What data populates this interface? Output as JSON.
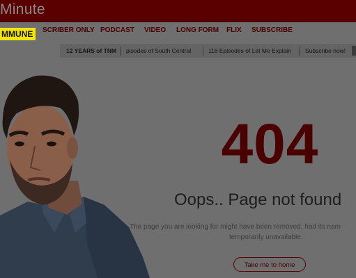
{
  "header": {
    "logo_text": "Minute",
    "background_color": "#5a0000"
  },
  "nav": {
    "badge": "MMUNE",
    "items": [
      {
        "label": "SCRIBER ONLY"
      },
      {
        "label": "PODCAST"
      },
      {
        "label": "VIDEO"
      },
      {
        "label": "LONG FORM"
      },
      {
        "label": "FLIX"
      },
      {
        "label": "SUBSCRIBE"
      }
    ]
  },
  "subnav": {
    "items": [
      {
        "label": "12 YEARS of TNM"
      },
      {
        "label": "pisodes of South Central"
      },
      {
        "label": "116 Episodes of Let Me Explain"
      },
      {
        "label": "Subscribe now!"
      }
    ]
  },
  "error": {
    "code": "404",
    "title": "Oops.. Page not found",
    "description_line1": "The page you are looking for might have been removed, had its nam",
    "description_line2": "temporarily unavailable.",
    "home_button": "Take me to home"
  },
  "colors": {
    "accent": "#4a0000",
    "overlay_background": "#6f6f6f",
    "badge": "#f2e500"
  }
}
